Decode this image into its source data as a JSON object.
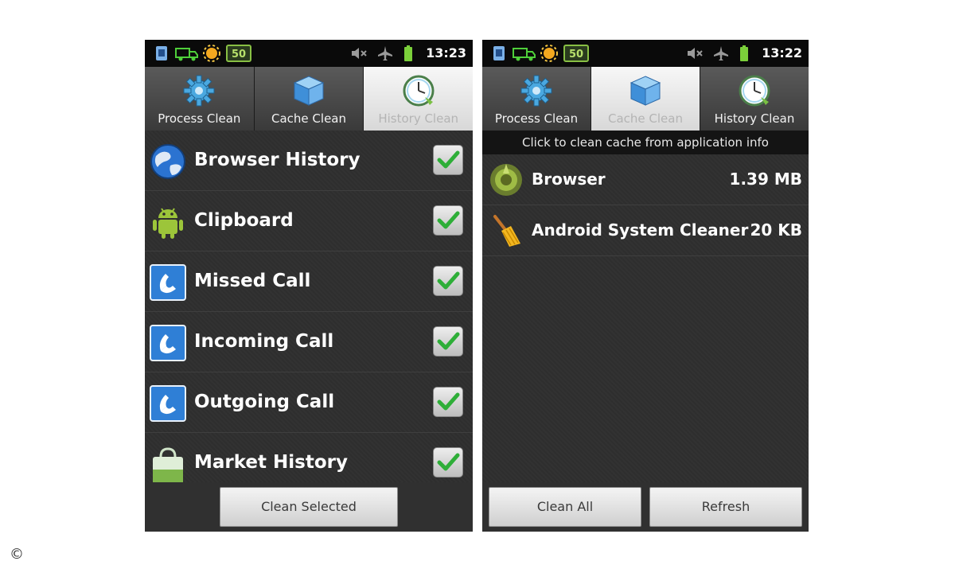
{
  "left_phone": {
    "status": {
      "clock": "13:23",
      "badge": "50"
    },
    "tabs": [
      {
        "label": "Process Clean",
        "icon": "gear-icon",
        "active": false
      },
      {
        "label": "Cache Clean",
        "icon": "cube-icon",
        "active": false
      },
      {
        "label": "History Clean",
        "icon": "clock-icon",
        "active": true
      }
    ],
    "items": [
      {
        "label": "Browser History",
        "icon": "globe-icon",
        "checked": true
      },
      {
        "label": "Clipboard",
        "icon": "android-icon",
        "checked": true
      },
      {
        "label": "Missed Call",
        "icon": "phone-icon",
        "checked": true
      },
      {
        "label": "Incoming Call",
        "icon": "phone-icon",
        "checked": true
      },
      {
        "label": "Outgoing Call",
        "icon": "phone-icon",
        "checked": true
      },
      {
        "label": "Market History",
        "icon": "market-bag-icon",
        "checked": true
      }
    ],
    "button": "Clean Selected"
  },
  "right_phone": {
    "status": {
      "clock": "13:22",
      "badge": "50"
    },
    "tabs": [
      {
        "label": "Process Clean",
        "icon": "gear-icon",
        "active": false
      },
      {
        "label": "Cache Clean",
        "icon": "cube-icon",
        "active": true
      },
      {
        "label": "History Clean",
        "icon": "clock-icon",
        "active": false
      }
    ],
    "header": "Click to clean cache from application info",
    "items": [
      {
        "label": "Browser",
        "size": "1.39 MB",
        "icon": "browser-globe-icon"
      },
      {
        "label": "Android System Cleaner",
        "size": "20 KB",
        "icon": "broom-icon"
      }
    ],
    "buttons": {
      "clean_all": "Clean All",
      "refresh": "Refresh"
    }
  },
  "copyright": "©",
  "colors": {
    "check": "#2eae38",
    "phone_bg": "#2b2b2b",
    "statusbar": "#0a0a0a",
    "accent_blue": "#2f7fd6"
  }
}
